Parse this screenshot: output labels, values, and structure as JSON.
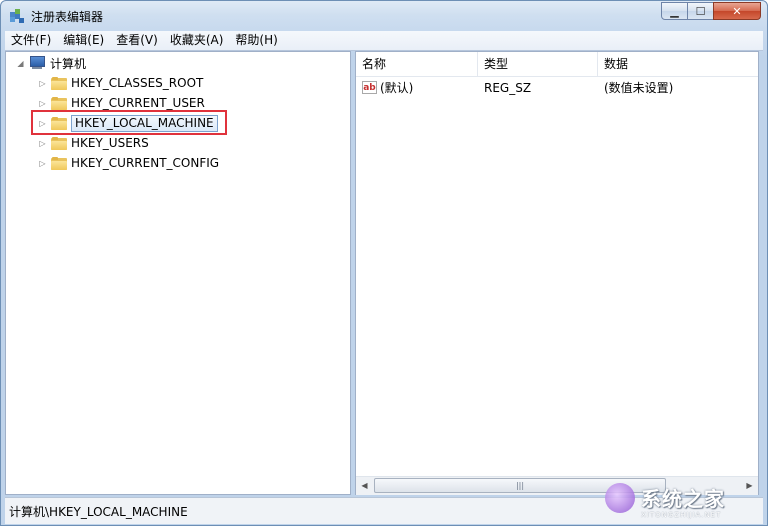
{
  "window": {
    "title": "注册表编辑器",
    "minimize_glyph": "▁",
    "maximize_glyph": "☐",
    "close_glyph": "✕"
  },
  "menu": [
    "文件(F)",
    "编辑(E)",
    "查看(V)",
    "收藏夹(A)",
    "帮助(H)"
  ],
  "tree": {
    "root_label": "计算机",
    "root_expander": "◢",
    "expander_glyph": "▷",
    "items": [
      {
        "label": "HKEY_CLASSES_ROOT",
        "selected": false
      },
      {
        "label": "HKEY_CURRENT_USER",
        "selected": false
      },
      {
        "label": "HKEY_LOCAL_MACHINE",
        "selected": true,
        "highlighted": true
      },
      {
        "label": "HKEY_USERS",
        "selected": false
      },
      {
        "label": "HKEY_CURRENT_CONFIG",
        "selected": false
      }
    ]
  },
  "values": {
    "headers": {
      "name": "名称",
      "type": "类型",
      "data": "数据"
    },
    "rows": [
      {
        "icon": "ab",
        "name": "(默认)",
        "type": "REG_SZ",
        "data": "(数值未设置)"
      }
    ]
  },
  "scrollbar": {
    "left_arrow": "◀",
    "right_arrow": "▶",
    "grip": "|||"
  },
  "status": {
    "path": "计算机\\HKEY_LOCAL_MACHINE"
  },
  "watermark": {
    "text": "系统之家",
    "sub": "XITONGZHIJIA.NET"
  },
  "colors": {
    "highlight_border": "#e0323c",
    "selection": "#dbe9f8"
  }
}
